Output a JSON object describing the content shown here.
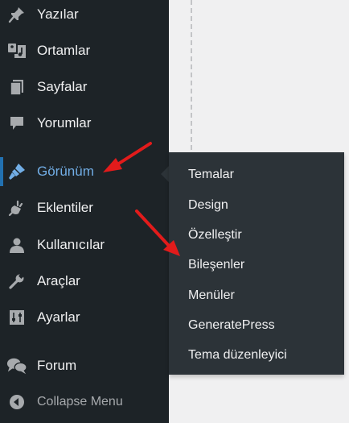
{
  "sidebar": {
    "items": [
      {
        "label": "Yazılar",
        "icon": "pin-icon"
      },
      {
        "label": "Ortamlar",
        "icon": "media-icon"
      },
      {
        "label": "Sayfalar",
        "icon": "pages-icon"
      },
      {
        "label": "Yorumlar",
        "icon": "comment-icon"
      },
      {
        "label": "Görünüm",
        "icon": "appearance-brush-icon"
      },
      {
        "label": "Eklentiler",
        "icon": "plugins-icon"
      },
      {
        "label": "Kullanıcılar",
        "icon": "users-icon"
      },
      {
        "label": "Araçlar",
        "icon": "tools-wrench-icon"
      },
      {
        "label": "Ayarlar",
        "icon": "settings-sliders-icon"
      },
      {
        "label": "Forum",
        "icon": "forum-bubbles-icon"
      }
    ],
    "collapse_label": "Collapse Menu"
  },
  "flyout": {
    "items": [
      {
        "label": "Temalar"
      },
      {
        "label": "Design"
      },
      {
        "label": "Özelleştir"
      },
      {
        "label": "Bileşenler"
      },
      {
        "label": "Menüler"
      },
      {
        "label": "GeneratePress"
      },
      {
        "label": "Tema düzenleyici"
      }
    ]
  },
  "colors": {
    "sidebar_bg": "#1d2327",
    "flyout_bg": "#2c3338",
    "active_text": "#72aee6",
    "annotation_arrow": "#e21b1b"
  }
}
